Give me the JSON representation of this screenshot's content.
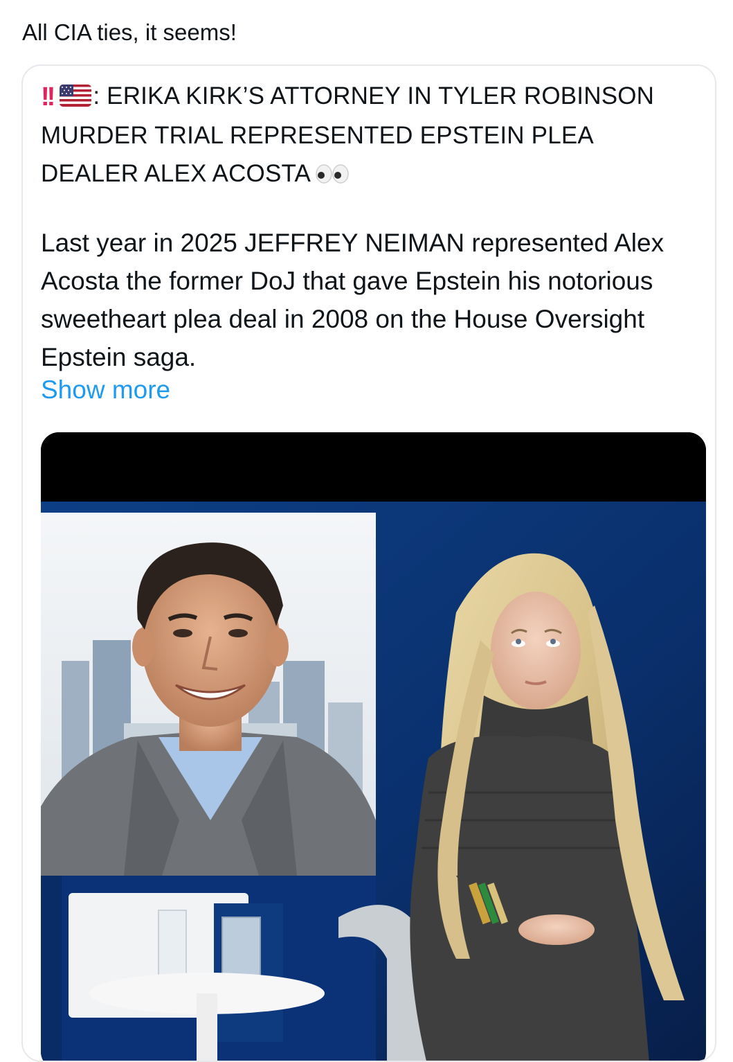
{
  "post": {
    "text": "All CIA ties, it seems!"
  },
  "quoted_post": {
    "headline_icons": [
      "double-exclamation-icon",
      "us-flag-icon"
    ],
    "headline_text": ": ERIKA KIRK’S ATTORNEY IN TYLER ROBINSON MURDER TRIAL REPRESENTED EPSTEIN PLEA DEALER ALEX ACOSTA",
    "headline_trailing_icon": "eyes-icon",
    "body_text": "Last year in 2025 JEFFREY NEIMAN represented Alex Acosta the former DoJ that gave Epstein his notorious sweetheart plea deal in 2008 on the House Oversight Epstein saga.",
    "show_more_label": "Show more",
    "media": {
      "type": "image",
      "description_icon": "photo-collage"
    }
  },
  "colors": {
    "text": "#0f1419",
    "link": "#1d9bf0",
    "border": "#e6e8eb",
    "exclaim": "#e0245e"
  }
}
